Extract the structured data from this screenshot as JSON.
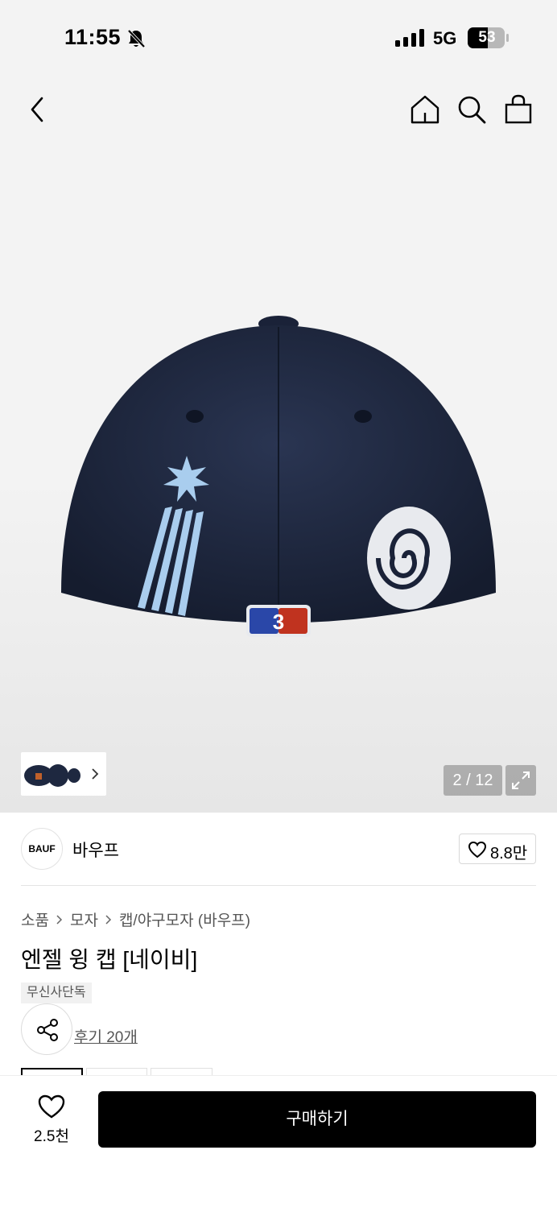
{
  "status_bar": {
    "time": "11:55",
    "network": "5G",
    "battery": "53"
  },
  "product_image": {
    "page_counter": "2 / 12"
  },
  "brand": {
    "logo_text": "BAUF",
    "name": "바우프",
    "like_count": "8.8만"
  },
  "breadcrumb": [
    "소품",
    "모자",
    "캡/야구모자 (바우프)"
  ],
  "product": {
    "title": "엔젤 윙 캡 [네이비]",
    "badge": "무신사단독",
    "review_link": "후기 20개"
  },
  "bottom_bar": {
    "wish_count": "2.5천",
    "buy_label": "구매하기"
  },
  "colors": {
    "cap_navy": "#1e2840",
    "embroidery_blue": "#a9cdee",
    "accent_black": "#000000"
  }
}
